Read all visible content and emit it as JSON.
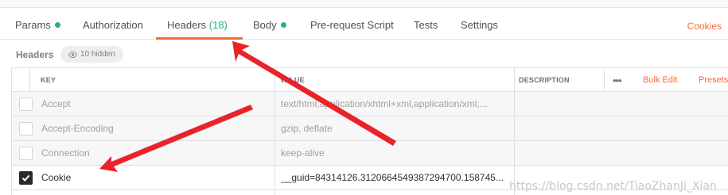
{
  "tabs": [
    {
      "label": "Params",
      "has_dot": true
    },
    {
      "label": "Authorization"
    },
    {
      "label": "Headers",
      "count": "(18)",
      "active": true
    },
    {
      "label": "Body",
      "has_dot": true
    },
    {
      "label": "Pre-request Script"
    },
    {
      "label": "Tests"
    },
    {
      "label": "Settings"
    }
  ],
  "cookies_link": "Cookies",
  "headers_section": {
    "title": "Headers",
    "hidden_label": "10 hidden",
    "hidden_icon": "eye-icon"
  },
  "table": {
    "columns": {
      "key": "KEY",
      "value": "VALUE",
      "description": "DESCRIPTION"
    },
    "actions": {
      "more": "•••",
      "bulk_edit": "Bulk Edit",
      "presets": "Presets"
    },
    "rows": [
      {
        "checked": false,
        "key": "Accept",
        "value": "text/html,application/xhtml+xml,application/xml;..."
      },
      {
        "checked": false,
        "key": "Accept-Encoding",
        "value": "gzip, deflate"
      },
      {
        "checked": false,
        "key": "Connection",
        "value": "keep-alive"
      },
      {
        "checked": true,
        "key": "Cookie",
        "value": "__guid=84314126.3120664549387294700.158745..."
      }
    ]
  },
  "watermark": "https://blog.csdn.net/TiaoZhanJi_Xian",
  "colors": {
    "accent": "#f26b3a",
    "dot_green": "#26b47f",
    "annotation_red": "#e8232a"
  }
}
